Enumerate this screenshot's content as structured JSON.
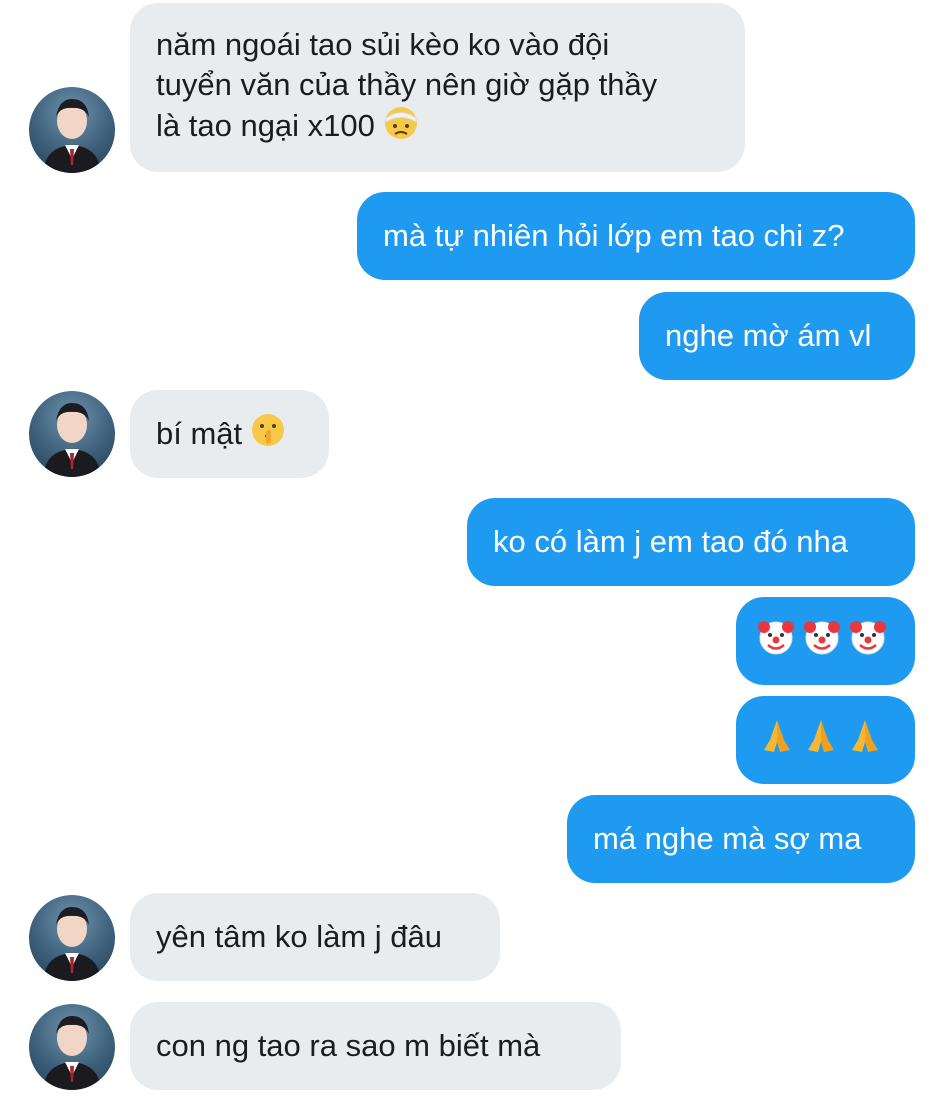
{
  "messages": [
    {
      "side": "in",
      "lines": [
        "năm ngoái tao sủi kèo ko vào đội",
        "tuyển văn của thầy nên giờ gặp thầy",
        "là tao ngại x100"
      ],
      "emoji": "head-bandage-emoji"
    },
    {
      "side": "out",
      "text": "mà tự nhiên hỏi lớp em tao chi z?"
    },
    {
      "side": "out",
      "text": "nghe mờ ám vl"
    },
    {
      "side": "in",
      "text": "bí mật",
      "emoji": "shushing-face-emoji"
    },
    {
      "side": "out",
      "text": "ko có làm j em tao đó nha"
    },
    {
      "side": "out",
      "emoji_row": [
        "clown-face-emoji",
        "clown-face-emoji",
        "clown-face-emoji"
      ]
    },
    {
      "side": "out",
      "emoji_row": [
        "folded-hands-emoji",
        "folded-hands-emoji",
        "folded-hands-emoji"
      ]
    },
    {
      "side": "out",
      "text": "má nghe mà sợ ma"
    },
    {
      "side": "in",
      "text": "yên tâm ko làm j đâu"
    },
    {
      "side": "in",
      "text": "con ng tao ra sao m biết mà"
    }
  ],
  "colors": {
    "incoming_bubble": "#e9ecef",
    "outgoing_bubble": "#1e9bf0",
    "incoming_text": "#1c1c1c",
    "outgoing_text": "#ffffff"
  },
  "icons": {
    "avatar": "contact-avatar"
  }
}
